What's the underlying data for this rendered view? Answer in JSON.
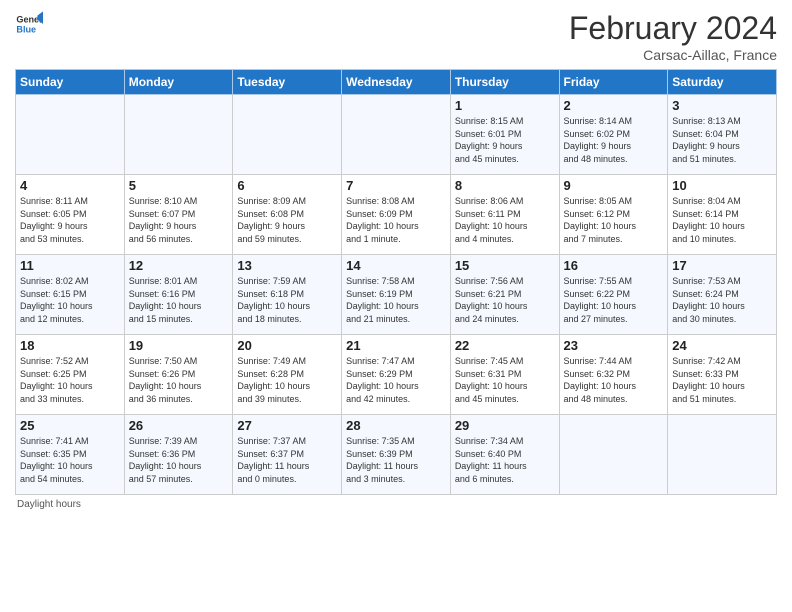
{
  "header": {
    "logo_line1": "General",
    "logo_line2": "Blue",
    "month_title": "February 2024",
    "subtitle": "Carsac-Aillac, France"
  },
  "footer": {
    "note": "Daylight hours"
  },
  "days_of_week": [
    "Sunday",
    "Monday",
    "Tuesday",
    "Wednesday",
    "Thursday",
    "Friday",
    "Saturday"
  ],
  "weeks": [
    [
      {
        "num": "",
        "info": ""
      },
      {
        "num": "",
        "info": ""
      },
      {
        "num": "",
        "info": ""
      },
      {
        "num": "",
        "info": ""
      },
      {
        "num": "1",
        "info": "Sunrise: 8:15 AM\nSunset: 6:01 PM\nDaylight: 9 hours\nand 45 minutes."
      },
      {
        "num": "2",
        "info": "Sunrise: 8:14 AM\nSunset: 6:02 PM\nDaylight: 9 hours\nand 48 minutes."
      },
      {
        "num": "3",
        "info": "Sunrise: 8:13 AM\nSunset: 6:04 PM\nDaylight: 9 hours\nand 51 minutes."
      }
    ],
    [
      {
        "num": "4",
        "info": "Sunrise: 8:11 AM\nSunset: 6:05 PM\nDaylight: 9 hours\nand 53 minutes."
      },
      {
        "num": "5",
        "info": "Sunrise: 8:10 AM\nSunset: 6:07 PM\nDaylight: 9 hours\nand 56 minutes."
      },
      {
        "num": "6",
        "info": "Sunrise: 8:09 AM\nSunset: 6:08 PM\nDaylight: 9 hours\nand 59 minutes."
      },
      {
        "num": "7",
        "info": "Sunrise: 8:08 AM\nSunset: 6:09 PM\nDaylight: 10 hours\nand 1 minute."
      },
      {
        "num": "8",
        "info": "Sunrise: 8:06 AM\nSunset: 6:11 PM\nDaylight: 10 hours\nand 4 minutes."
      },
      {
        "num": "9",
        "info": "Sunrise: 8:05 AM\nSunset: 6:12 PM\nDaylight: 10 hours\nand 7 minutes."
      },
      {
        "num": "10",
        "info": "Sunrise: 8:04 AM\nSunset: 6:14 PM\nDaylight: 10 hours\nand 10 minutes."
      }
    ],
    [
      {
        "num": "11",
        "info": "Sunrise: 8:02 AM\nSunset: 6:15 PM\nDaylight: 10 hours\nand 12 minutes."
      },
      {
        "num": "12",
        "info": "Sunrise: 8:01 AM\nSunset: 6:16 PM\nDaylight: 10 hours\nand 15 minutes."
      },
      {
        "num": "13",
        "info": "Sunrise: 7:59 AM\nSunset: 6:18 PM\nDaylight: 10 hours\nand 18 minutes."
      },
      {
        "num": "14",
        "info": "Sunrise: 7:58 AM\nSunset: 6:19 PM\nDaylight: 10 hours\nand 21 minutes."
      },
      {
        "num": "15",
        "info": "Sunrise: 7:56 AM\nSunset: 6:21 PM\nDaylight: 10 hours\nand 24 minutes."
      },
      {
        "num": "16",
        "info": "Sunrise: 7:55 AM\nSunset: 6:22 PM\nDaylight: 10 hours\nand 27 minutes."
      },
      {
        "num": "17",
        "info": "Sunrise: 7:53 AM\nSunset: 6:24 PM\nDaylight: 10 hours\nand 30 minutes."
      }
    ],
    [
      {
        "num": "18",
        "info": "Sunrise: 7:52 AM\nSunset: 6:25 PM\nDaylight: 10 hours\nand 33 minutes."
      },
      {
        "num": "19",
        "info": "Sunrise: 7:50 AM\nSunset: 6:26 PM\nDaylight: 10 hours\nand 36 minutes."
      },
      {
        "num": "20",
        "info": "Sunrise: 7:49 AM\nSunset: 6:28 PM\nDaylight: 10 hours\nand 39 minutes."
      },
      {
        "num": "21",
        "info": "Sunrise: 7:47 AM\nSunset: 6:29 PM\nDaylight: 10 hours\nand 42 minutes."
      },
      {
        "num": "22",
        "info": "Sunrise: 7:45 AM\nSunset: 6:31 PM\nDaylight: 10 hours\nand 45 minutes."
      },
      {
        "num": "23",
        "info": "Sunrise: 7:44 AM\nSunset: 6:32 PM\nDaylight: 10 hours\nand 48 minutes."
      },
      {
        "num": "24",
        "info": "Sunrise: 7:42 AM\nSunset: 6:33 PM\nDaylight: 10 hours\nand 51 minutes."
      }
    ],
    [
      {
        "num": "25",
        "info": "Sunrise: 7:41 AM\nSunset: 6:35 PM\nDaylight: 10 hours\nand 54 minutes."
      },
      {
        "num": "26",
        "info": "Sunrise: 7:39 AM\nSunset: 6:36 PM\nDaylight: 10 hours\nand 57 minutes."
      },
      {
        "num": "27",
        "info": "Sunrise: 7:37 AM\nSunset: 6:37 PM\nDaylight: 11 hours\nand 0 minutes."
      },
      {
        "num": "28",
        "info": "Sunrise: 7:35 AM\nSunset: 6:39 PM\nDaylight: 11 hours\nand 3 minutes."
      },
      {
        "num": "29",
        "info": "Sunrise: 7:34 AM\nSunset: 6:40 PM\nDaylight: 11 hours\nand 6 minutes."
      },
      {
        "num": "",
        "info": ""
      },
      {
        "num": "",
        "info": ""
      }
    ]
  ]
}
